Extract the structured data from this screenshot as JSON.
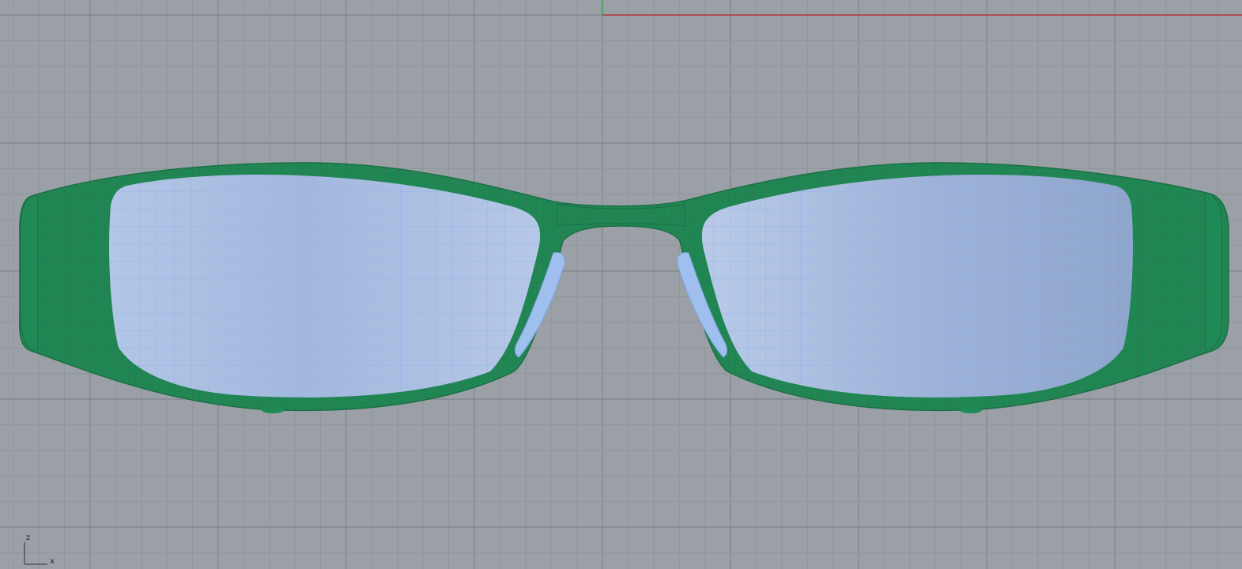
{
  "viewport": {
    "background": "#9aa0a6",
    "minor_grid_color": "#8d939a",
    "major_grid_color": "#7f858c",
    "x_axis_color": "#b33a3a",
    "z_axis_color": "#38a050"
  },
  "model": {
    "frame_color": "#1f8a55",
    "frame_mesh_color": "#2a6e4a",
    "lens_color": "#a9bfe4",
    "lens_mesh_color": "#8fb3ee"
  },
  "axis_gizmo": {
    "up_label": "z",
    "right_label": "x"
  }
}
